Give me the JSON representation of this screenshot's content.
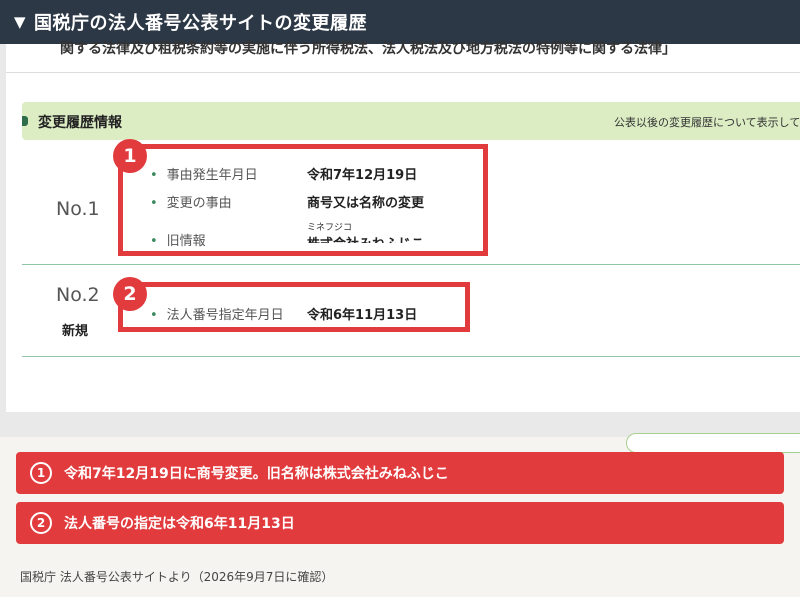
{
  "header": {
    "toggle_icon": "▼",
    "title": "国税庁の法人番号公表サイトの変更履歴"
  },
  "screenshot": {
    "cut_text": "関する法律及び租税条約等の実施に伴う所得税法、法人税法及び地方税法の特例等に関する法律」",
    "section": {
      "title": "変更履歴情報",
      "note": "公表以後の変更履歴について表示してい"
    },
    "entries": [
      {
        "no": "No.1",
        "fields": [
          {
            "key": "事由発生年月日",
            "value": "令和7年12月19日"
          },
          {
            "key": "変更の事由",
            "value": "商号又は名称の変更"
          },
          {
            "key": "旧情報",
            "kana": "ミネフジコ",
            "value": "株式会社みねふじこ"
          }
        ]
      },
      {
        "no": "No.2",
        "sub": "新規",
        "fields": [
          {
            "key": "法人番号指定年月日",
            "value": "令和6年11月13日"
          }
        ]
      }
    ],
    "badges": [
      "1",
      "2"
    ]
  },
  "callouts": [
    {
      "num": "1",
      "text": "令和7年12月19日に商号変更。旧名称は株式会社みねふじこ"
    },
    {
      "num": "2",
      "text": "法人番号の指定は令和6年11月13日"
    }
  ],
  "footer": "国税庁 法人番号公表サイトより（2026年9月7日に確認）",
  "colors": {
    "header_bg": "#2c3846",
    "accent_red": "#e23b3d",
    "section_bg": "#dcedc4",
    "row_line": "#8fc4a4"
  }
}
